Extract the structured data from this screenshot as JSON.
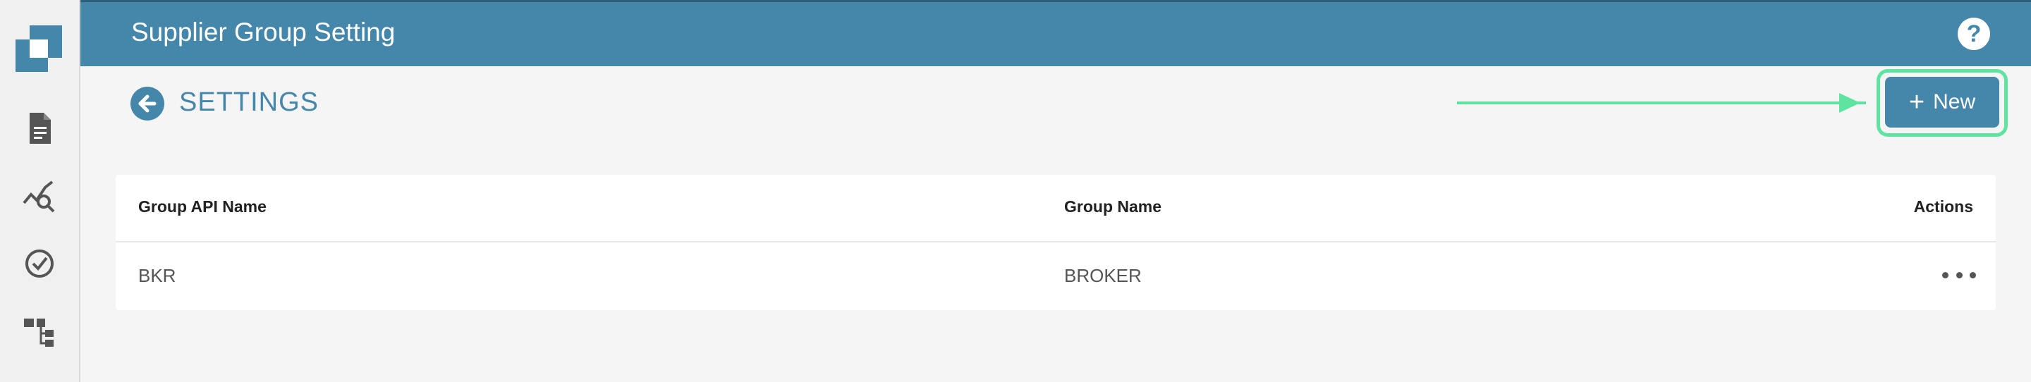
{
  "header": {
    "title": "Supplier Group Setting",
    "help_label": "?"
  },
  "sidebar": {
    "items": [
      {
        "icon": "document-icon"
      },
      {
        "icon": "analytics-search-icon"
      },
      {
        "icon": "check-circle-icon"
      },
      {
        "icon": "hierarchy-icon"
      }
    ]
  },
  "subheader": {
    "title": "SETTINGS"
  },
  "toolbar": {
    "new_label": "New",
    "new_plus": "+"
  },
  "table": {
    "columns": [
      "Group API Name",
      "Group Name",
      "Actions"
    ],
    "rows": [
      {
        "api_name": "BKR",
        "name": "BROKER"
      }
    ]
  },
  "colors": {
    "brand": "#4586ab",
    "highlight": "#5fe3a1"
  }
}
